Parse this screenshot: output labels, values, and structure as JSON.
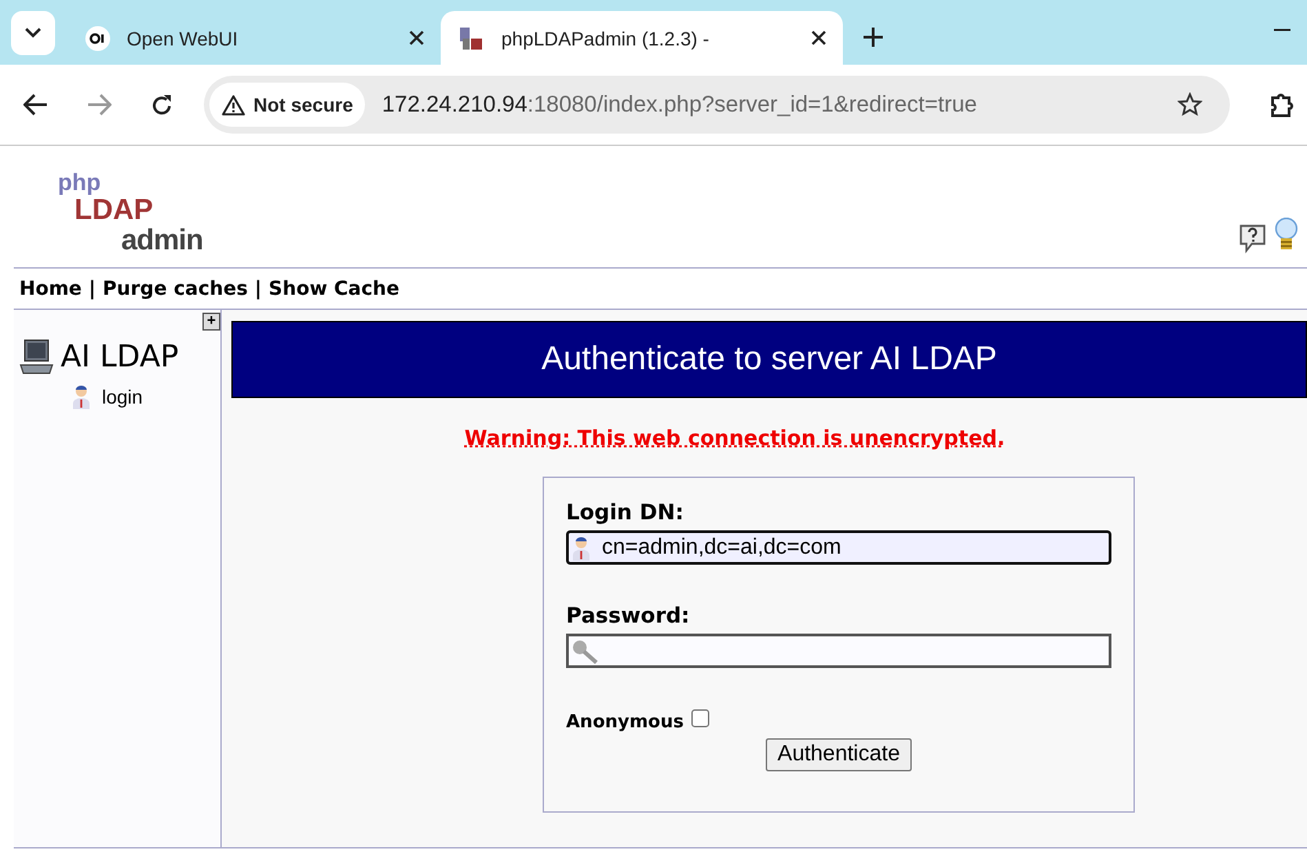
{
  "browser": {
    "tabs": [
      {
        "title": "Open WebUI",
        "selected": false
      },
      {
        "title": "phpLDAPadmin (1.2.3) -",
        "selected": true
      }
    ],
    "security": "Not secure",
    "url_host": "172.24.210.94",
    "url_path": ":18080/index.php?server_id=1&redirect=true"
  },
  "logo": {
    "line1": "php",
    "line2": "LDAP",
    "line3": "admin"
  },
  "nav": [
    "Home",
    "Purge caches",
    "Show Cache"
  ],
  "nav_separator": "|",
  "sidebar": {
    "expand": "+",
    "server": "AI LDAP",
    "items": [
      {
        "label": "login"
      }
    ]
  },
  "header": "Authenticate to server AI LDAP",
  "warning": "Warning: This web connection is unencrypted.",
  "form": {
    "login_label": "Login DN:",
    "login_value": "cn=admin,dc=ai,dc=com",
    "password_label": "Password:",
    "anonymous_label": "Anonymous",
    "anonymous_checked": false,
    "submit": "Authenticate"
  }
}
